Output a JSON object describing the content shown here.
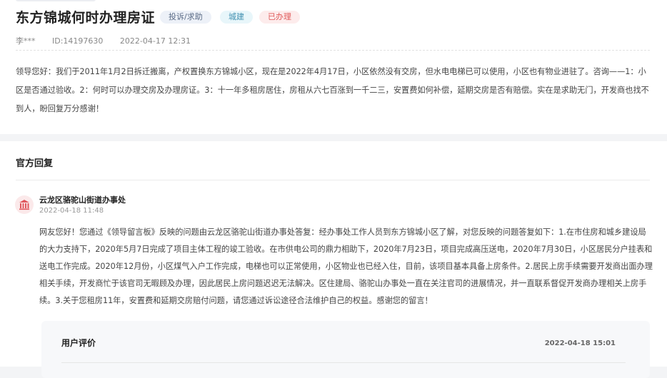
{
  "question": {
    "title": "东方锦城何时办理房证",
    "tags": {
      "type": "投诉/求助",
      "category": "城建",
      "status": "已办理"
    },
    "author": "李***",
    "id": "ID:14197630",
    "time": "2022-04-17 12:31",
    "content": "领导您好：我们于2011年1月2日拆迁搬离，产权置换东方锦城小区，现在是2022年4月17日，小区依然没有交房，但水电电梯已可以使用，小区也有物业进驻了。咨询——1：小区是否通过验收。2：何时可以办理交房及办理房证。3：十一年多租房居住，房租从六七百涨到一千二三，安置费如何补偿，延期交房是否有赔偿。实在是求助无门，开发商也找不到人，盼回复万分感谢！"
  },
  "reply": {
    "section_title": "官方回复",
    "department": "云龙区骆驼山街道办事处",
    "time": "2022-04-18 11:48",
    "content": "网友您好！您通过《领导留言板》反映的问题由云龙区骆驼山街道办事处答复：经办事处工作人员到东方锦城小区了解，对您反映的问题答复如下：1.在市住房和城乡建设局的大力支持下，2020年5月7日完成了项目主体工程的竣工验收。在市供电公司的鼎力相助下，2020年7月23日，项目完成高压送电，2020年7月30日，小区居民分户挂表和送电工作完成。2020年12月份，小区煤气入户工作完成，电梯也可以正常使用，小区物业也已经入住，目前，该项目基本具备上房条件。2.居民上房手续需要开发商出面办理相关手续，开发商忙于该官司无暇顾及办理，因此居民上房问题迟迟无法解决。区住建局、骆驼山办事处一直在关注官司的进展情况，并一直联系督促开发商办理相关上房手续。3.关于您租房11年，安置费和延期交房赔付问题，请您通过诉讼途径合法维护自己的权益。感谢您的留言！"
  },
  "evaluation": {
    "title": "用户评价",
    "time": "2022-04-18 15:01"
  },
  "icons": {
    "department_avatar": "government-building-icon"
  },
  "colors": {
    "status_tag": "#e05a5a",
    "avatar_icon": "#e0575c"
  }
}
